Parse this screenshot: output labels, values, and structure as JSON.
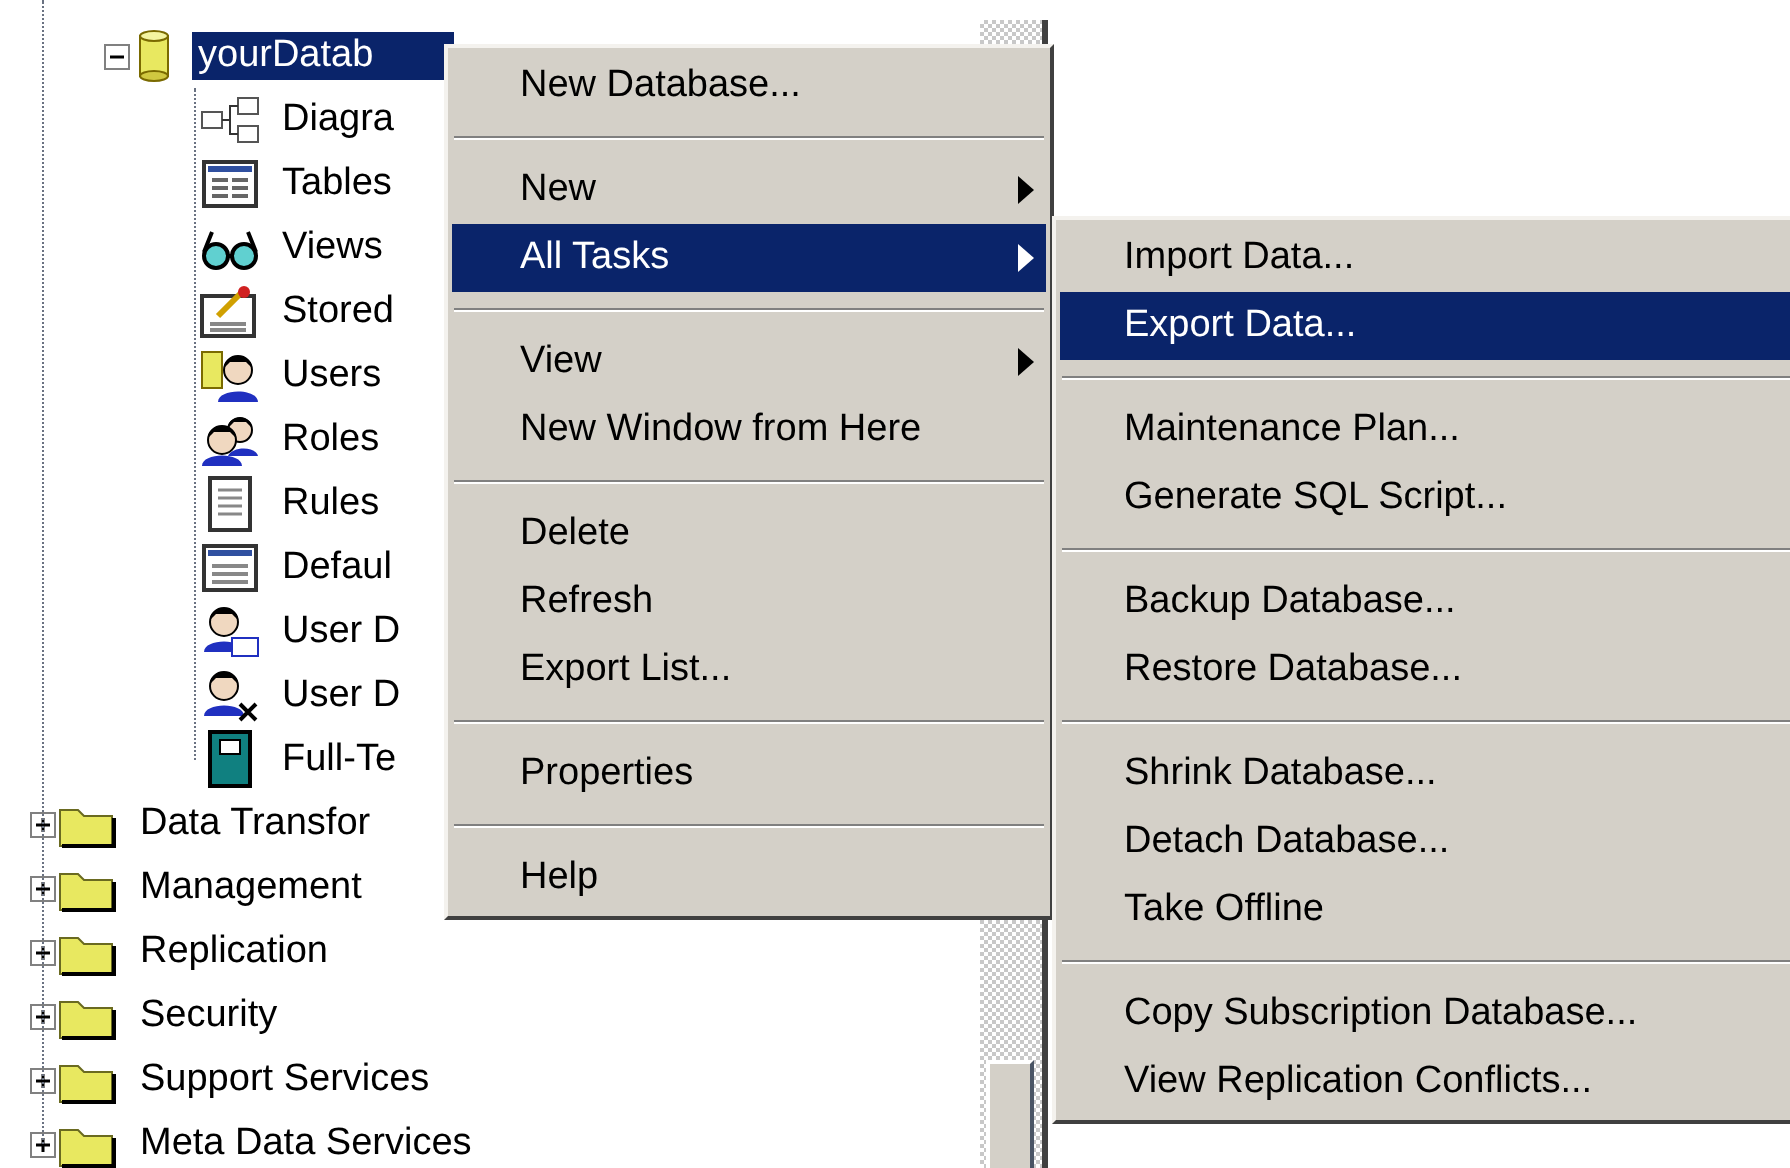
{
  "tree": {
    "items": [
      {
        "kind": "database",
        "label": "yourDatab",
        "selected": true,
        "expanded": true,
        "children": [
          {
            "kind": "diagram",
            "label": "Diagra",
            "selected": false
          },
          {
            "kind": "table",
            "label": "Tables",
            "selected": false
          },
          {
            "kind": "view",
            "label": "Views",
            "selected": false
          },
          {
            "kind": "procedure",
            "label": "Stored",
            "selected": false
          },
          {
            "kind": "user",
            "label": "Users",
            "selected": false
          },
          {
            "kind": "role",
            "label": "Roles",
            "selected": false
          },
          {
            "kind": "rule",
            "label": "Rules",
            "selected": false
          },
          {
            "kind": "default",
            "label": "Defaul",
            "selected": false
          },
          {
            "kind": "user_type",
            "label": "User D",
            "selected": false
          },
          {
            "kind": "user_function",
            "label": "User D",
            "selected": false
          },
          {
            "kind": "catalog",
            "label": "Full-Te",
            "selected": false
          }
        ]
      },
      {
        "kind": "folder",
        "label": "Data Transfor",
        "selected": false,
        "expanded": false
      },
      {
        "kind": "folder",
        "label": "Management",
        "selected": false,
        "expanded": false
      },
      {
        "kind": "folder",
        "label": "Replication",
        "selected": false,
        "expanded": false
      },
      {
        "kind": "folder",
        "label": "Security",
        "selected": false,
        "expanded": false
      },
      {
        "kind": "folder",
        "label": "Support Services",
        "selected": false,
        "expanded": false
      },
      {
        "kind": "folder",
        "label": "Meta Data Services",
        "selected": false,
        "expanded": false
      }
    ]
  },
  "context_menu": {
    "items": [
      {
        "kind": "item",
        "label": "New Database...",
        "selected": false,
        "has_submenu": false
      },
      {
        "kind": "separator"
      },
      {
        "kind": "item",
        "label": "New",
        "selected": false,
        "has_submenu": true
      },
      {
        "kind": "item",
        "label": "All Tasks",
        "selected": true,
        "has_submenu": true
      },
      {
        "kind": "separator"
      },
      {
        "kind": "item",
        "label": "View",
        "selected": false,
        "has_submenu": true
      },
      {
        "kind": "item",
        "label": "New Window from Here",
        "selected": false,
        "has_submenu": false
      },
      {
        "kind": "separator"
      },
      {
        "kind": "item",
        "label": "Delete",
        "selected": false,
        "has_submenu": false
      },
      {
        "kind": "item",
        "label": "Refresh",
        "selected": false,
        "has_submenu": false
      },
      {
        "kind": "item",
        "label": "Export List...",
        "selected": false,
        "has_submenu": false
      },
      {
        "kind": "separator"
      },
      {
        "kind": "item",
        "label": "Properties",
        "selected": false,
        "has_submenu": false
      },
      {
        "kind": "separator"
      },
      {
        "kind": "item",
        "label": "Help",
        "selected": false,
        "has_submenu": false
      }
    ]
  },
  "submenu": {
    "items": [
      {
        "kind": "item",
        "label": "Import Data...",
        "selected": false
      },
      {
        "kind": "item",
        "label": "Export Data...",
        "selected": true
      },
      {
        "kind": "separator"
      },
      {
        "kind": "item",
        "label": "Maintenance Plan...",
        "selected": false
      },
      {
        "kind": "item",
        "label": "Generate SQL Script...",
        "selected": false
      },
      {
        "kind": "separator"
      },
      {
        "kind": "item",
        "label": "Backup Database...",
        "selected": false
      },
      {
        "kind": "item",
        "label": "Restore Database...",
        "selected": false
      },
      {
        "kind": "separator"
      },
      {
        "kind": "item",
        "label": "Shrink Database...",
        "selected": false
      },
      {
        "kind": "item",
        "label": "Detach Database...",
        "selected": false
      },
      {
        "kind": "item",
        "label": "Take Offline",
        "selected": false
      },
      {
        "kind": "separator"
      },
      {
        "kind": "item",
        "label": "Copy Subscription Database...",
        "selected": false
      },
      {
        "kind": "item",
        "label": "View Replication Conflicts...",
        "selected": false
      }
    ]
  }
}
